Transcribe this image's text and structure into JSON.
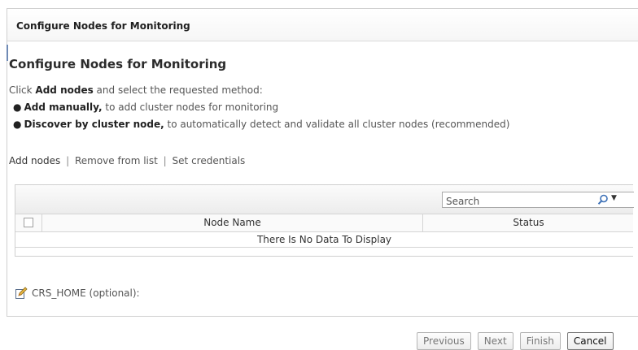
{
  "dialog": {
    "title": "Configure Nodes for Monitoring"
  },
  "main": {
    "heading": "Configure Nodes for Monitoring",
    "intro_prefix": "Click ",
    "intro_bold": "Add nodes",
    "intro_suffix": " and select the requested method:",
    "bullets": [
      {
        "bold": "Add manually,",
        "text": " to add cluster nodes for monitoring"
      },
      {
        "bold": "Discover by cluster node,",
        "text": " to automatically detect and validate all cluster nodes (recommended)"
      }
    ]
  },
  "actions": {
    "add_nodes": "Add nodes",
    "remove": "Remove from list",
    "credentials": "Set credentials",
    "separator": "|"
  },
  "grid": {
    "search_placeholder": "Search",
    "columns": [
      "Node Name",
      "Status"
    ],
    "empty_message": "There Is No Data To Display"
  },
  "crs_home": {
    "label": "CRS_HOME (optional):"
  },
  "footer": {
    "previous": "Previous",
    "next": "Next",
    "finish": "Finish",
    "cancel": "Cancel"
  },
  "icons": {
    "search": "search-icon",
    "dropdown": "chevron-down-icon",
    "edit": "edit-icon"
  }
}
